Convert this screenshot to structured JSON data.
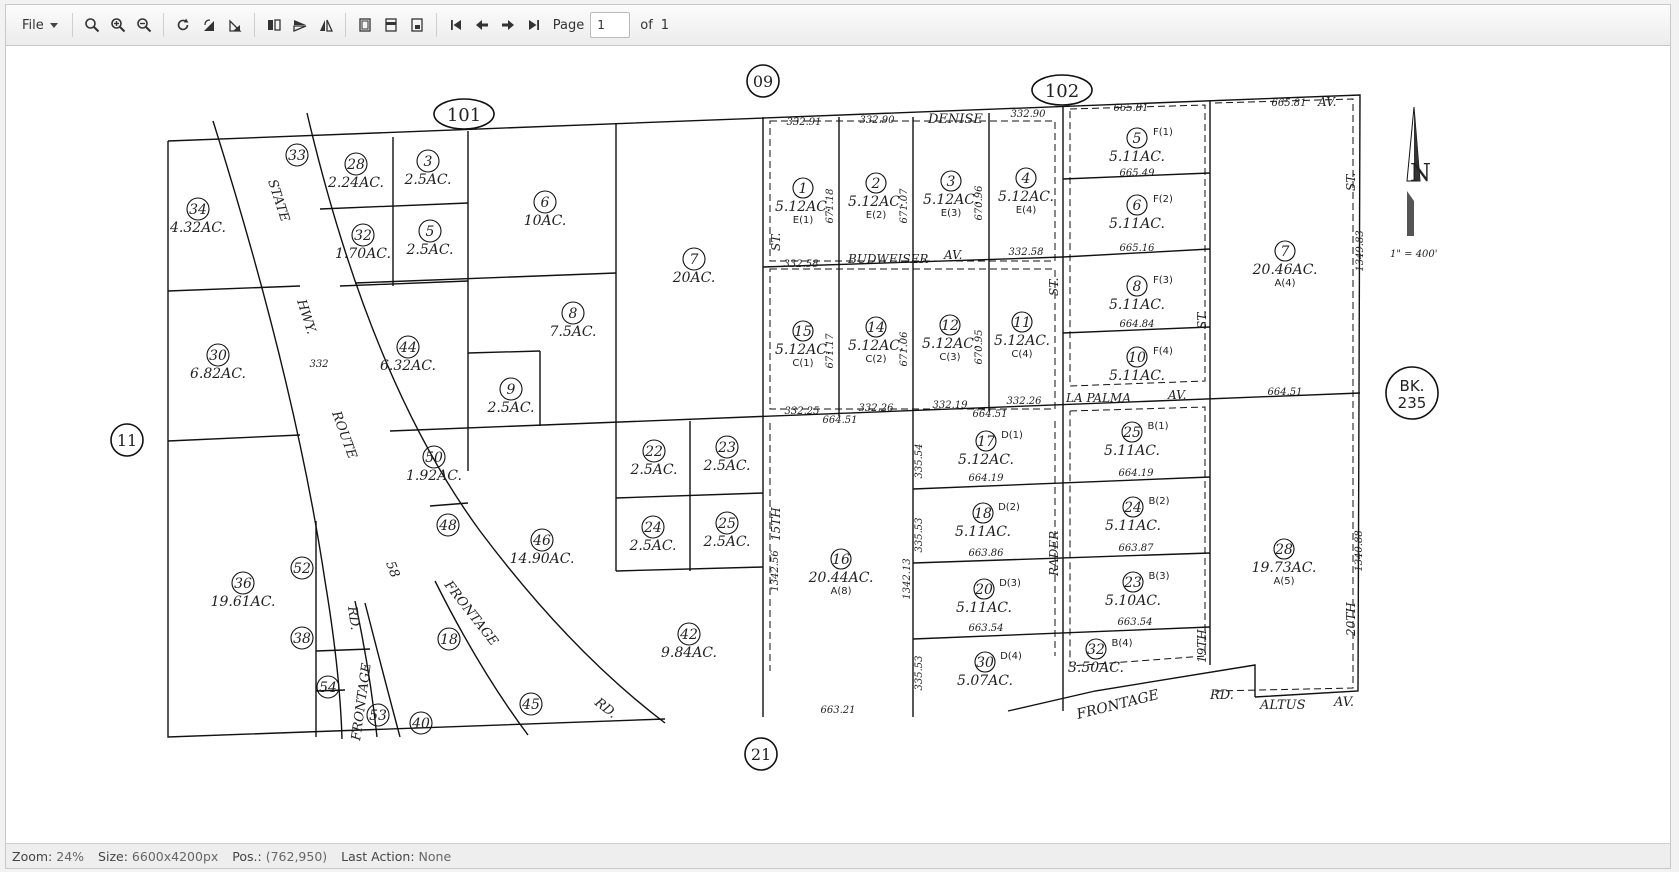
{
  "toolbar": {
    "file_label": "File",
    "page_label": "Page",
    "page_value": "1",
    "of_label": "of",
    "total_pages": "1"
  },
  "status": {
    "zoom_label": "Zoom:",
    "zoom_value": "24%",
    "size_label": "Size:",
    "size_value": "6600x4200px",
    "pos_label": "Pos.:",
    "pos_value": "(762,950)",
    "action_label": "Last Action:",
    "action_value": "None"
  },
  "map": {
    "book_top": "09",
    "book_bottom": "21",
    "book_left": "11",
    "book_right_line1": "BK.",
    "book_right_line2": "235",
    "page_101": "101",
    "page_102": "102",
    "scale": "1\" = 400'",
    "north": "N",
    "roads": {
      "state": "STATE",
      "hwy": "HWY.",
      "route": "ROUTE",
      "route_num": "58",
      "frontage_rd_left": "FRONTAGE",
      "rd_left": "RD.",
      "frontage_diag": "FRONTAGE",
      "rd_diag": "RD.",
      "frontage_bottom": "FRONTAGE",
      "rd_bottom": "RD.",
      "altus": "ALTUS",
      "av": "AV.",
      "denise": "DENISE",
      "budweiser": "BUDWEISER",
      "budweiser_av": "AV.",
      "la_palma": "LA PALMA",
      "la_palma_av": "AV.",
      "fifteenth": "15TH",
      "st_15": "ST.",
      "nineteenth": "19TH",
      "st_19": "ST.",
      "twentieth": "20TH",
      "st_20": "ST.",
      "rader": "RADER",
      "st_rader": "ST.",
      "av_top": "AV."
    },
    "parcels": [
      {
        "n": "34",
        "a": "4.32AC."
      },
      {
        "n": "33",
        "a": ""
      },
      {
        "n": "28",
        "a": "2.24AC."
      },
      {
        "n": "3",
        "a": "2.5AC."
      },
      {
        "n": "32",
        "a": "1.70AC."
      },
      {
        "n": "5",
        "a": "2.5AC."
      },
      {
        "n": "6",
        "a": "10AC."
      },
      {
        "n": "7",
        "a": "20AC."
      },
      {
        "n": "30",
        "a": "6.82AC."
      },
      {
        "n": "44",
        "a": "6.32AC."
      },
      {
        "n": "8",
        "a": "7.5AC."
      },
      {
        "n": "9",
        "a": "2.5AC."
      },
      {
        "n": "50",
        "a": "1.92AC."
      },
      {
        "n": "48",
        "a": ""
      },
      {
        "n": "46",
        "a": "14.90AC."
      },
      {
        "n": "22",
        "a": "2.5AC."
      },
      {
        "n": "23",
        "a": "2.5AC."
      },
      {
        "n": "24",
        "a": "2.5AC."
      },
      {
        "n": "25",
        "a": "2.5AC."
      },
      {
        "n": "42",
        "a": "9.84AC."
      },
      {
        "n": "36",
        "a": "19.61AC."
      },
      {
        "n": "52",
        "a": ""
      },
      {
        "n": "38",
        "a": ""
      },
      {
        "n": "54",
        "a": ""
      },
      {
        "n": "53",
        "a": ""
      },
      {
        "n": "40",
        "a": ""
      },
      {
        "n": "18",
        "a": ""
      },
      {
        "n": "45",
        "a": ""
      }
    ],
    "lots": [
      {
        "n": "1",
        "a": "5.12AC.",
        "s": "E(1)"
      },
      {
        "n": "2",
        "a": "5.12AC.",
        "s": "E(2)"
      },
      {
        "n": "3",
        "a": "5.12AC.",
        "s": "E(3)"
      },
      {
        "n": "4",
        "a": "5.12AC.",
        "s": "E(4)"
      },
      {
        "n": "15",
        "a": "5.12AC.",
        "s": "C(1)"
      },
      {
        "n": "14",
        "a": "5.12AC.",
        "s": "C(2)"
      },
      {
        "n": "12",
        "a": "5.12AC.",
        "s": "C(3)"
      },
      {
        "n": "11",
        "a": "5.12AC.",
        "s": "C(4)"
      },
      {
        "n": "5",
        "a": "5.11AC.",
        "s": "F(1)"
      },
      {
        "n": "6",
        "a": "5.11AC.",
        "s": "F(2)"
      },
      {
        "n": "8",
        "a": "5.11AC.",
        "s": "F(3)"
      },
      {
        "n": "10",
        "a": "5.11AC.",
        "s": "F(4)"
      },
      {
        "n": "7",
        "a": "20.46AC.",
        "s": "A(4)"
      },
      {
        "n": "16",
        "a": "20.44AC.",
        "s": "A(8)"
      },
      {
        "n": "17",
        "a": "5.12AC.",
        "s": "D(1)"
      },
      {
        "n": "18",
        "a": "5.11AC.",
        "s": "D(2)"
      },
      {
        "n": "20",
        "a": "5.11AC.",
        "s": "D(3)"
      },
      {
        "n": "30",
        "a": "5.07AC.",
        "s": "D(4)"
      },
      {
        "n": "25",
        "a": "5.11AC.",
        "s": "B(1)"
      },
      {
        "n": "24",
        "a": "5.11AC.",
        "s": "B(2)"
      },
      {
        "n": "23",
        "a": "5.10AC.",
        "s": "B(3)"
      },
      {
        "n": "32",
        "a": "3.50AC.",
        "s": "B(4)"
      },
      {
        "n": "28",
        "a": "19.73AC.",
        "s": "A(5)"
      }
    ],
    "dims": [
      "664.51",
      "664.51",
      "664.51",
      "663.21",
      "665.81",
      "665.81",
      "665.49",
      "665.16",
      "664.84",
      "664.19",
      "664.19",
      "663.86",
      "663.87",
      "663.54",
      "663.54",
      "332.58",
      "332.58",
      "332.25",
      "332.26",
      "332.19",
      "332.26",
      "332.91",
      "332.90",
      "332.90",
      "671.18",
      "671.07",
      "670.96",
      "671.17",
      "671.06",
      "670.95",
      "335.54",
      "335.53",
      "335.53",
      "1342.13",
      "1342.56",
      "1349.83",
      "1340.88",
      "332"
    ]
  }
}
